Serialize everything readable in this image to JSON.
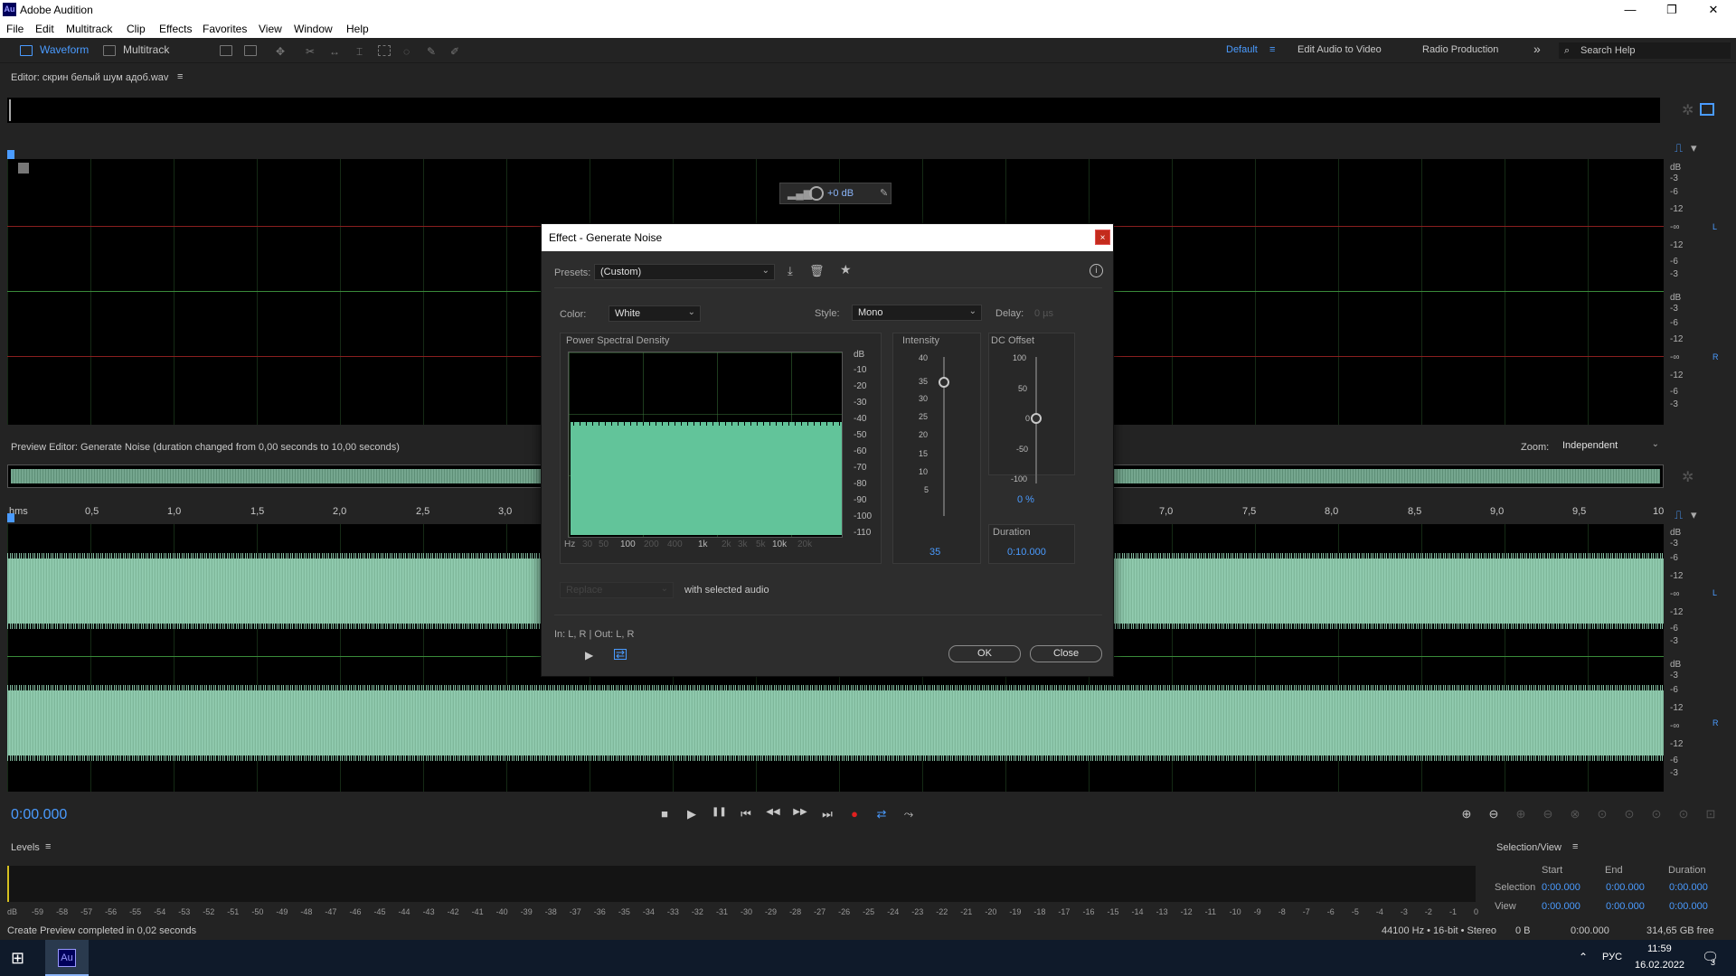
{
  "app": {
    "title": "Adobe Audition",
    "logo_text": "Au"
  },
  "window_buttons": {
    "minimize": "—",
    "restore": "❐",
    "close": "✕"
  },
  "menu": [
    "File",
    "Edit",
    "Multitrack",
    "Clip",
    "Effects",
    "Favorites",
    "View",
    "Window",
    "Help"
  ],
  "toolbar": {
    "waveform_label": "Waveform",
    "multitrack_label": "Multitrack",
    "workspaces": [
      "Default",
      "Edit Audio to Video",
      "Radio Production"
    ],
    "more": "»",
    "search_placeholder": "Search Help"
  },
  "editor": {
    "title": "Editor: скрин белый шум адоб.wav",
    "menu_icon": "≡",
    "hud_gain": "+0 dB",
    "db_top": [
      "dB",
      "-3",
      "-6",
      "-12",
      "-∞",
      "-12",
      "-6",
      "-3"
    ],
    "db_bottom": [
      "dB",
      "-3",
      "-6",
      "-12",
      "-∞",
      "-12",
      "-6",
      "-3"
    ],
    "channel_left": "L",
    "channel_right": "R"
  },
  "preview": {
    "title": "Preview Editor: Generate Noise (duration changed from 0,00 seconds to 10,00 seconds)",
    "zoom_label": "Zoom:",
    "zoom_value": "Independent",
    "ruler": [
      "hms",
      "0,5",
      "1,0",
      "1,5",
      "2,0",
      "2,5",
      "3,0",
      "7,0",
      "7,5",
      "8,0",
      "8,5",
      "9,0",
      "9,5",
      "10"
    ],
    "db_top": [
      "dB",
      "-3",
      "-6",
      "-12",
      "-∞",
      "-12",
      "-6",
      "-3"
    ],
    "db_bottom": [
      "dB",
      "-3",
      "-6",
      "-12",
      "-∞",
      "-12",
      "-6",
      "-3"
    ],
    "channel_left": "L",
    "channel_right": "R"
  },
  "transport": {
    "time": "0:00.000",
    "buttons": [
      "■",
      "▶",
      "❚❚",
      "⏮",
      "◀◀",
      "▶▶",
      "⏭",
      "●",
      "⇄",
      "⤳"
    ]
  },
  "levels": {
    "title": "Levels",
    "menu_icon": "≡",
    "scale": [
      "dB",
      "-59",
      "-58",
      "-57",
      "-56",
      "-55",
      "-54",
      "-53",
      "-52",
      "-51",
      "-50",
      "-49",
      "-48",
      "-47",
      "-46",
      "-45",
      "-44",
      "-43",
      "-42",
      "-41",
      "-40",
      "-39",
      "-38",
      "-37",
      "-36",
      "-35",
      "-34",
      "-33",
      "-32",
      "-31",
      "-30",
      "-29",
      "-28",
      "-27",
      "-26",
      "-25",
      "-24",
      "-23",
      "-22",
      "-21",
      "-20",
      "-19",
      "-18",
      "-17",
      "-16",
      "-15",
      "-14",
      "-13",
      "-12",
      "-11",
      "-10",
      "-9",
      "-8",
      "-7",
      "-6",
      "-5",
      "-4",
      "-3",
      "-2",
      "-1",
      "0"
    ]
  },
  "selection_view": {
    "title": "Selection/View",
    "menu_icon": "≡",
    "headers": [
      "Start",
      "End",
      "Duration"
    ],
    "rows": [
      {
        "label": "Selection",
        "start": "0:00.000",
        "end": "0:00.000",
        "duration": "0:00.000"
      },
      {
        "label": "View",
        "start": "0:00.000",
        "end": "0:00.000",
        "duration": "0:00.000"
      }
    ]
  },
  "status": {
    "message": "Create Preview completed in 0,02 seconds",
    "format": "44100 Hz • 16-bit • Stereo",
    "size": "0 B",
    "duration": "0:00.000",
    "free": "314,65 GB free"
  },
  "taskbar": {
    "app_icon": "Au",
    "lang": "РУС",
    "time": "11:59",
    "date": "16.02.2022",
    "notif": "3"
  },
  "dialog": {
    "title": "Effect - Generate Noise",
    "close": "×",
    "presets_label": "Presets:",
    "presets_value": "(Custom)",
    "color_label": "Color:",
    "color_value": "White",
    "style_label": "Style:",
    "style_value": "Mono",
    "delay_label": "Delay:",
    "delay_value": "0 µs",
    "psd_title": "Power Spectral Density",
    "psd_db": [
      "dB",
      "-10",
      "-20",
      "-30",
      "-40",
      "-50",
      "-60",
      "-70",
      "-80",
      "-90",
      "-100",
      "-110"
    ],
    "psd_freq": [
      "Hz",
      "30",
      "50",
      "100",
      "200",
      "400",
      "1k",
      "2k",
      "3k",
      "5k",
      "10k",
      "20k"
    ],
    "psd_fill_color": "#62c49a",
    "intensity_title": "Intensity",
    "intensity_ticks": [
      "40",
      "35",
      "30",
      "25",
      "20",
      "15",
      "10",
      "5"
    ],
    "intensity_value": "35",
    "dc_title": "DC Offset",
    "dc_ticks": [
      "100",
      "50",
      "0",
      "-50",
      "-100"
    ],
    "dc_value": "0 %",
    "duration_title": "Duration",
    "duration_value": "0:10.000",
    "mode_value": "Replace",
    "mode_text": "with selected audio",
    "io_text": "In: L, R | Out: L, R",
    "ok": "OK",
    "close_btn": "Close"
  },
  "colors": {
    "accent": "#4a9bff",
    "waveform": "#8ac4a8",
    "record": "#e0201f"
  }
}
